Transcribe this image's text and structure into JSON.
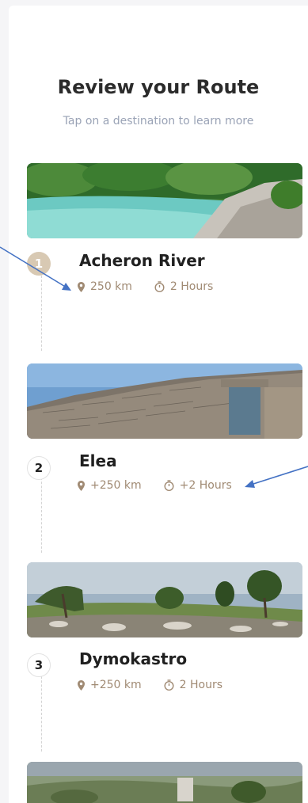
{
  "header": {
    "title": "Review your Route",
    "subtitle": "Tap on a destination to learn more"
  },
  "route": [
    {
      "step": "1",
      "name": "Acheron River",
      "distance": "250 km",
      "duration": "2 Hours",
      "active": true
    },
    {
      "step": "2",
      "name": "Elea",
      "distance": "+250 km",
      "duration": "+2 Hours",
      "active": false
    },
    {
      "step": "3",
      "name": "Dymokastro",
      "distance": "+250 km",
      "duration": "2 Hours",
      "active": false
    }
  ],
  "colors": {
    "accent": "#a08a73",
    "badge_active": "#d8c9b3",
    "arrow": "#4472c4"
  }
}
